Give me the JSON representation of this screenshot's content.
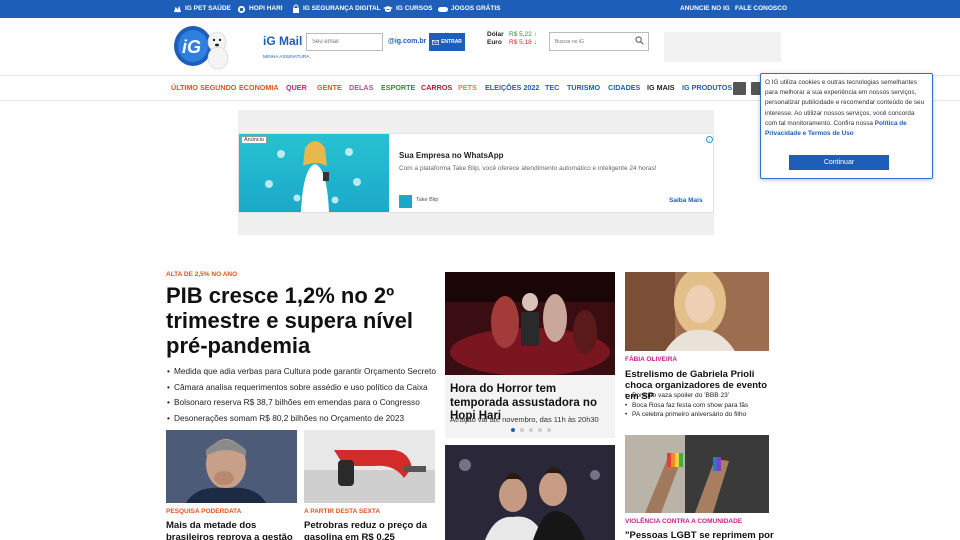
{
  "topbar": {
    "items": [
      "IG PET SAÚDE",
      "HOPI HARI",
      "IG SEGURANÇA DIGITAL",
      "IG CURSOS",
      "JOGOS GRÁTIS"
    ],
    "right": [
      "ANUNCIE NO IG",
      "FALE CONOSCO"
    ]
  },
  "header": {
    "mail_title": "iG Mail",
    "mail_sub": "MINHA ASSINATURA",
    "mail_placeholder": "Seu email",
    "mail_domain": "@ig.com.br",
    "mail_button": "ENTRAR",
    "currency": [
      {
        "name": "Dólar",
        "value": "R$ 5,22",
        "color": "#2e8b3a",
        "arrow": "up"
      },
      {
        "name": "Euro",
        "value": "R$ 5,18",
        "color": "#d62828",
        "arrow": "down"
      }
    ],
    "search_placeholder": "Buscar no iG"
  },
  "nav": [
    {
      "label": "ÚLTIMO SEGUNDO",
      "color": "#e0541b"
    },
    {
      "label": "ECONOMIA",
      "color": "#e0541b"
    },
    {
      "label": "QUER",
      "color": "#c61f8c"
    },
    {
      "label": "GENTE",
      "color": "#e0541b"
    },
    {
      "label": "DELAS",
      "color": "#b04fa0"
    },
    {
      "label": "ESPORTE",
      "color": "#2e8b3a"
    },
    {
      "label": "CARROS",
      "color": "#b01b2e"
    },
    {
      "label": "PETS",
      "color": "#f07a3e"
    },
    {
      "label": "ELEIÇÕES 2022",
      "color": "#1d5fb8"
    },
    {
      "label": "TEC",
      "color": "#1d5fb8"
    },
    {
      "label": "TURISMO",
      "color": "#1d5fb8"
    },
    {
      "label": "CIDADES",
      "color": "#1d5fb8"
    },
    {
      "label": "IG MAIS",
      "color": "#222222"
    },
    {
      "label": "IG PRODUTOS",
      "color": "#1d5fb8"
    }
  ],
  "cookie": {
    "text": "O IG utiliza cookies e outras tecnologias semelhantes para melhorar a sua experiência em nossos serviços, personalizar publicidade e recomendar conteúdo de seu interesse. Ao utilizar nossos serviços, você concorda com tal monitoramento. Confira nossa ",
    "link": "Política de Privacidade e Termos de Uso",
    "button": "Continuar"
  },
  "ad": {
    "label": "Anúncio",
    "headline": "Sua Empresa no WhatsApp",
    "description": "Com a plataforma Take Blip, você oferece atendimento automático e inteligente 24 horas!",
    "brand": "Take Blip",
    "cta": "Saiba Mais"
  },
  "main": {
    "kicker": "ALTA DE 2,5% NO ANO",
    "headline": "PIB cresce 1,2% no 2º trimestre e supera nível pré-pandemia",
    "bullets": [
      "Medida que adia verbas para Cultura pode garantir Orçamento Secreto",
      "Câmara analisa requerimentos sobre assédio e uso político da Caixa",
      "Bolsonaro reserva R$ 38,7 bilhões em emendas para o Congresso",
      "Desonerações somam R$ 80,2 bilhões no Orçamento de 2023"
    ]
  },
  "cards": {
    "poll_kicker": "PESQUISA PODERDATA",
    "poll_title": "Mais da metade dos brasileiros reprova a gestão Bolsonaro",
    "fuel_kicker": "A PARTIR DESTA SEXTA",
    "fuel_title": "Petrobras reduz o preço da gasolina em R$ 0,25",
    "hero_title": "Hora do Horror tem temporada assustadora no Hopi Hari",
    "hero_sub": "Atração vai até novembro, das 11h às 20h30",
    "side_kicker": "FÁBIA OLIVEIRA",
    "side_title": "Estrelismo de Gabriela Prioli choca organizadores de evento em SP",
    "side_items": [
      "Boninho vaza spoiler do 'BBB 23'",
      "Boca Rosa faz festa com show para fãs",
      "PA celebra primeiro aniversário do filho"
    ],
    "lgbt_kicker": "VIOLÊNCIA CONTRA A COMUNIDADE",
    "lgbt_title": "\"Pessoas LGBT se reprimem por medo\""
  }
}
